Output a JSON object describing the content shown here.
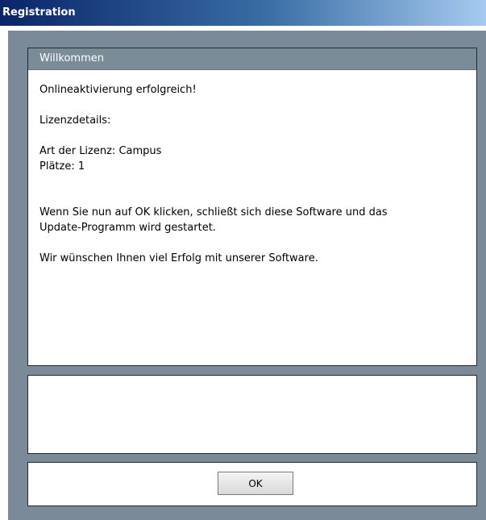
{
  "window": {
    "title": "Registration"
  },
  "welcome_panel": {
    "header": "Willkommen",
    "success_message": "Onlineaktivierung erfolgreich!",
    "license_details_label": "Lizenzdetails:",
    "license_type": "Art der Lizenz: Campus",
    "seats": "Plätze: 1",
    "instruction_line1": "Wenn Sie nun auf OK klicken, schließt sich diese Software und das",
    "instruction_line2": "Update-Programm wird gestartet.",
    "closing_message": "Wir wünschen Ihnen viel Erfolg mit unserer Software."
  },
  "buttons": {
    "ok_label": "OK"
  },
  "colors": {
    "frame_background": "#7a8a99",
    "header_background": "#7b8c99",
    "titlebar_start": "#0a246a",
    "titlebar_end": "#a6caf0"
  }
}
